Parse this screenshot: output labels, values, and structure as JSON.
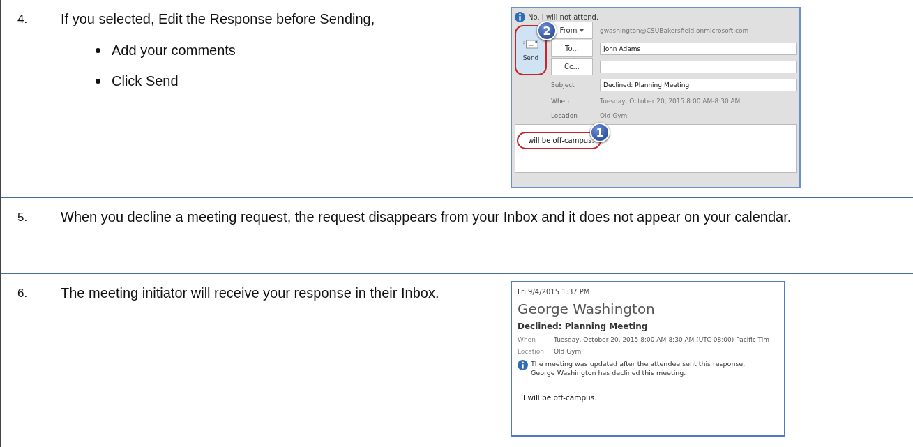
{
  "steps": [
    {
      "kind": "figure",
      "number": "4.",
      "text": "If you selected, Edit the Response before Sending,",
      "bullets": [
        "Add your comments",
        "Click Send"
      ],
      "figure": {
        "kind": "compose",
        "info": "No. I will not attend.",
        "send": "Send",
        "from_label": "From",
        "from_value": "gwashington@CSUBakersfield.onmicrosoft.com",
        "to_label": "To...",
        "to_value": "John Adams",
        "cc_label": "Cc...",
        "subject_label": "Subject",
        "subject_value": "Declined: Planning Meeting",
        "when_label": "When",
        "when_value": "Tuesday, October 20, 2015 8:00 AM-8:30 AM",
        "location_label": "Location",
        "location_value": "Old Gym",
        "body": "I will be off-campus.",
        "callouts": [
          "2",
          "1"
        ]
      }
    },
    {
      "kind": "full",
      "number": "5.",
      "text": "When you decline a meeting request, the request disappears from your Inbox and it does not appear on your calendar."
    },
    {
      "kind": "figure",
      "number": "6.",
      "text": "The meeting initiator will receive your response in their Inbox.",
      "figure": {
        "kind": "received",
        "date": "Fri 9/4/2015 1:37 PM",
        "sender": "George Washington",
        "subject": "Declined: Planning Meeting",
        "when_label": "When",
        "when_value": "Tuesday, October 20, 2015 8:00 AM-8:30 AM (UTC-08:00) Pacific Tim",
        "location_label": "Location",
        "location_value": "Old Gym",
        "info": [
          "The meeting was updated after the attendee sent this response.",
          "George Washington has declined this meeting."
        ],
        "body": "I will be off-campus."
      }
    }
  ]
}
